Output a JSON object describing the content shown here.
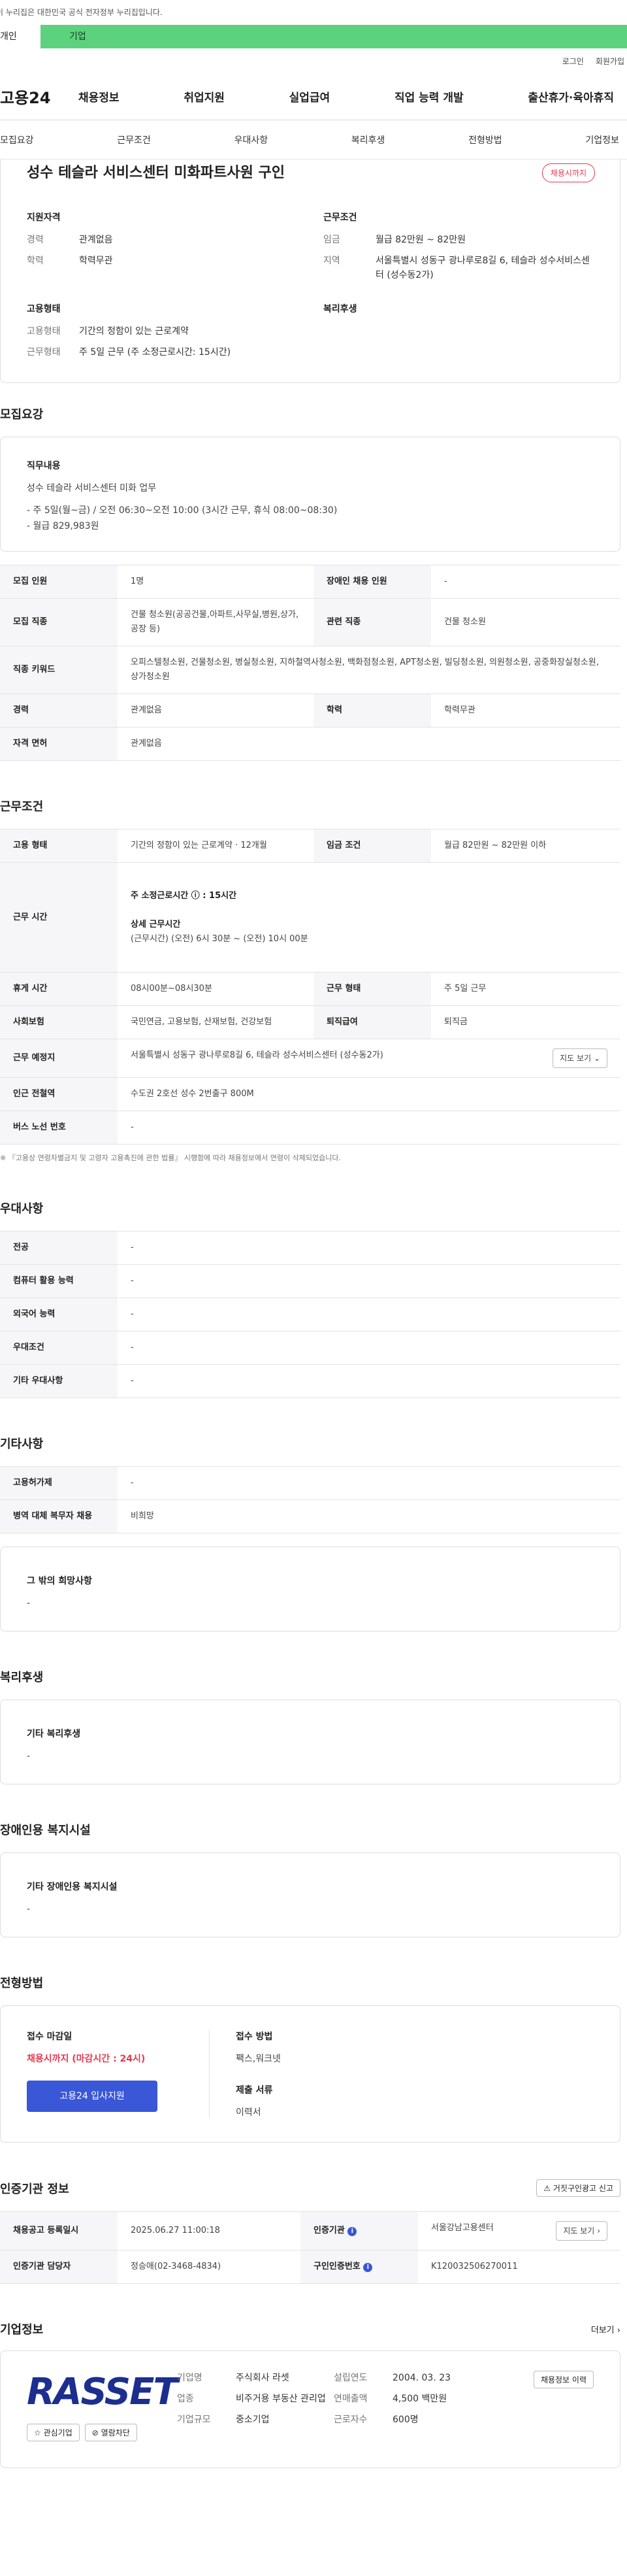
{
  "top_notice": "이 누리집은 대한민국 공식 전자정부 누리집입니다.",
  "user_tabs": [
    "개인",
    "기업"
  ],
  "top_links": [
    "로그인",
    "회원가입"
  ],
  "logo": "고용24",
  "gnb": [
    "채용정보",
    "취업지원",
    "실업급여",
    "직업 능력 개발",
    "출산휴가·육아휴직"
  ],
  "subnav": [
    "모집요강",
    "근무조건",
    "우대사항",
    "복리후생",
    "전형방법",
    "기업정보"
  ],
  "header": {
    "title": "성수 테슬라 서비스센터 미화파트사원 구인",
    "badge": "채용시까지",
    "qual_title": "지원자격",
    "qual": [
      {
        "k": "경력",
        "v": "관계없음"
      },
      {
        "k": "학력",
        "v": "학력무관"
      }
    ],
    "work_title": "근무조건",
    "work": [
      {
        "k": "임금",
        "v": "월급 82만원 ~ 82만원"
      },
      {
        "k": "지역",
        "v": "서울특별시 성동구 광나루로8길 6, 테슬라 성수서비스센터 (성수동2가)"
      }
    ],
    "emp_title": "고용형태",
    "emp": [
      {
        "k": "고용형태",
        "v": "기간의 정함이 있는 근로계약"
      },
      {
        "k": "근무형태",
        "v": "주 5일 근무 (주 소정근로시간: 15시간)"
      }
    ],
    "welfare_title": "복리후생"
  },
  "recruit": {
    "title": "모집요강",
    "duty_h": "직무내용",
    "duty_lines": [
      "성수 테슬라 서비스센터 미화 업무",
      "",
      "- 주 5일(월~금) / 오전 06:30~오전 10:00 (3시간 근무, 휴식 08:00~08:30)",
      "- 월급 829,983원"
    ],
    "rows": [
      {
        "k1": "모집 인원",
        "v1": "1명",
        "k2": "장애인 채용 인원",
        "v2": "-"
      },
      {
        "k1": "모집 직종",
        "v1": "건물 청소원(공공건물,아파트,사무실,병원,상가,공장 등)",
        "k2": "관련 직종",
        "v2": "건물 청소원"
      },
      {
        "k1": "직종 키워드",
        "v1": "오피스텔청소원, 건물청소원, 병실청소원, 지하철역사청소원, 백화점청소원, APT청소원, 빌딩청소원, 의원청소원, 공중화장실청소원, 상가청소원"
      },
      {
        "k1": "경력",
        "v1": "관계없음",
        "k2": "학력",
        "v2": "학력무관"
      },
      {
        "k1": "자격 면허",
        "v1": "관계없음"
      }
    ]
  },
  "conditions": {
    "title": "근무조건",
    "emp_k": "고용 형태",
    "emp_v": "기간의 정함이 있는 근로계약 · 12개월",
    "wage_k": "임금 조건",
    "wage_v": "월급 82만원 ~ 82만원 이하",
    "time_k": "근무 시간",
    "time_h1": "주 소정근로시간 ⓘ : 15시간",
    "time_h2": "상세 근무시간",
    "time_v2": "(근무시간) (오전) 6시 30분 ~ (오전) 10시 00분",
    "rest_k": "휴게 시간",
    "rest_v": "08시00분~08시30분",
    "type_k": "근무 형태",
    "type_v": "주 5일 근무",
    "ins_k": "사회보험",
    "ins_v": "국민연금, 고용보험, 산재보험, 건강보험",
    "ret_k": "퇴직급여",
    "ret_v": "퇴직금",
    "loc_k": "근무 예정지",
    "loc_v": "서울특별시 성동구 광나루로8길 6, 테슬라 성수서비스센터 (성수동2가)",
    "map_btn": "지도 보기",
    "sub_k": "인근 전철역",
    "sub_v": "수도권 2호선 성수 2번출구 800M",
    "bus_k": "버스 노선 번호",
    "bus_v": "-",
    "note": "※ 『고용상 연령차별금지 및 고령자 고용촉진에 관한 법률』 시행함에 따라 채용정보에서 연령이 삭제되었습니다."
  },
  "prefer": {
    "title": "우대사항",
    "rows": [
      {
        "k": "전공",
        "v": "-"
      },
      {
        "k": "컴퓨터 활용 능력",
        "v": "-"
      },
      {
        "k": "외국어 능력",
        "v": "-"
      },
      {
        "k": "우대조건",
        "v": "-"
      },
      {
        "k": "기타 우대사항",
        "v": "-"
      }
    ]
  },
  "etc": {
    "title": "기타사항",
    "rows": [
      {
        "k": "고용허가제",
        "v": "-"
      },
      {
        "k": "병역 대체 복무자 채용",
        "v": "비희망"
      }
    ],
    "other_h": "그 밖의 희망사항",
    "other_v": "-"
  },
  "welfare": {
    "title": "복리후생",
    "h": "기타 복리후생",
    "v": "-"
  },
  "disabled": {
    "title": "장애인용 복지시설",
    "h": "기타 장애인용 복지시설",
    "v": "-"
  },
  "screening": {
    "title": "전형방법",
    "deadline_h": "접수 마감일",
    "deadline_v": "채용시까지 (마감시간 : 24시)",
    "apply_btn": "고용24 입사지원",
    "method_h": "접수 방법",
    "method_v": "팩스,워크넷",
    "docs_h": "제출 서류",
    "docs_v": "이력서"
  },
  "agency": {
    "title": "인증기관 정보",
    "report_btn": "거짓구인광고 신고",
    "rows": [
      {
        "k1": "채용공고 등록일시",
        "v1": "2025.06.27 11:00:18",
        "k2": "인증기관",
        "v2": "서울강남고용센터"
      },
      {
        "k1": "인증기관 담당자",
        "v1": "정승애(02-3468-4834)",
        "k2": "구인인증번호",
        "v2": "K120032506270011"
      }
    ],
    "map_btn": "지도 보기"
  },
  "company": {
    "title": "기업정보",
    "more": "더보기",
    "logo_text": "RASSET",
    "fav_btn": "관심기업",
    "block_btn": "열람차단",
    "info": [
      {
        "k": "기업명",
        "v": "주식회사 라셋"
      },
      {
        "k": "업종",
        "v": "비주거용 부동산 관리업"
      },
      {
        "k": "기업규모",
        "v": "중소기업"
      }
    ],
    "info2": [
      {
        "k": "설립연도",
        "v": "2004. 03. 23"
      },
      {
        "k": "연매출액",
        "v": "4,500 백만원"
      },
      {
        "k": "근로자수",
        "v": "600명"
      }
    ],
    "history_btn": "채용정보 이력"
  }
}
